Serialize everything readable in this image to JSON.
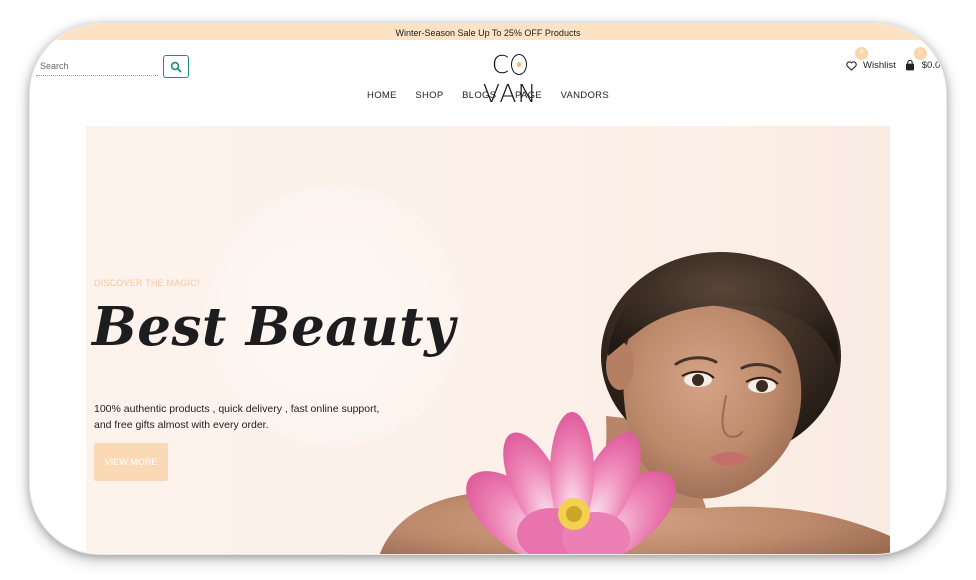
{
  "announcement": "Winter-Season Sale Up To 25% OFF Products",
  "search": {
    "placeholder": "Search"
  },
  "brand": {
    "logo_text": "COVAN"
  },
  "nav": [
    "HOME",
    "SHOP",
    "BLOGS",
    "PAGE",
    "VANDORS"
  ],
  "tools": {
    "wishlist_label": "Wishlist",
    "wishlist_count": "0",
    "cart_total": "$0.0",
    "cart_count": "0"
  },
  "hero": {
    "kicker": "DISCOVER THE MAGIC!",
    "headline": "Best Beauty",
    "description": "100% authentic products , quick delivery , fast online support, and free gifts almost with every order.",
    "cta_label": "VIEW MORE"
  },
  "colors": {
    "accent": "#fde3c3",
    "badge": "#fbd6a8",
    "cta": "#fcd9b5",
    "search_button": "#1e8f74",
    "flower": "#e86aa8"
  },
  "icons": {
    "search": "search-icon",
    "wishlist": "heart-icon",
    "cart": "shopping-bag-icon"
  }
}
